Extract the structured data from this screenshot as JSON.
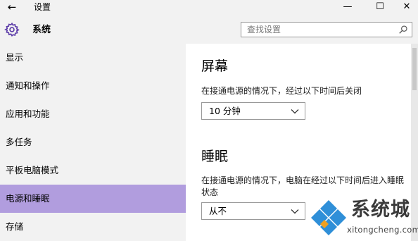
{
  "window": {
    "title": "设置",
    "back_glyph": "←",
    "minimize_glyph": "—",
    "maximize_glyph": "☐",
    "close_glyph": "✕"
  },
  "header": {
    "section_title": "系统",
    "section_icon": "gear-icon",
    "search_placeholder": "查找设置",
    "accent_color": "#5b3aa8"
  },
  "sidebar": {
    "items": [
      {
        "label": "显示",
        "active": false
      },
      {
        "label": "通知和操作",
        "active": false
      },
      {
        "label": "应用和功能",
        "active": false
      },
      {
        "label": "多任务",
        "active": false
      },
      {
        "label": "平板电脑模式",
        "active": false
      },
      {
        "label": "电源和睡眠",
        "active": true
      },
      {
        "label": "存储",
        "active": false
      }
    ],
    "active_color": "#b19dde"
  },
  "main": {
    "screen": {
      "heading": "屏幕",
      "description": "在接通电源的情况下，经过以下时间后关闭",
      "dropdown_value": "10 分钟"
    },
    "sleep": {
      "heading": "睡眠",
      "description": "在接通电源的情况下，电脑在经过以下时间后进入睡眠状态",
      "dropdown_value": "从不"
    }
  },
  "watermark": {
    "brand": "系统城",
    "url": "xitongcheng.com"
  }
}
